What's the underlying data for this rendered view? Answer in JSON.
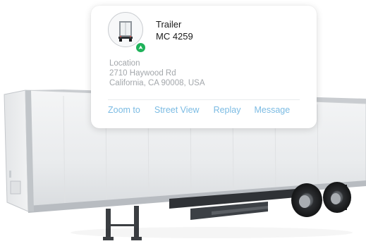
{
  "vehicle": {
    "name": "Trailer",
    "plate": "MC 4259",
    "status_color": "#1fb25a",
    "avatar_icon": "trailer-icon"
  },
  "location": {
    "label": "Location",
    "line1": "2710 Haywood Rd",
    "line2": "California, CA 90008, USA"
  },
  "actions": {
    "zoom": "Zoom to",
    "street_view": "Street View",
    "replay": "Replay",
    "message": "Message",
    "color": "#7bbbe3"
  }
}
